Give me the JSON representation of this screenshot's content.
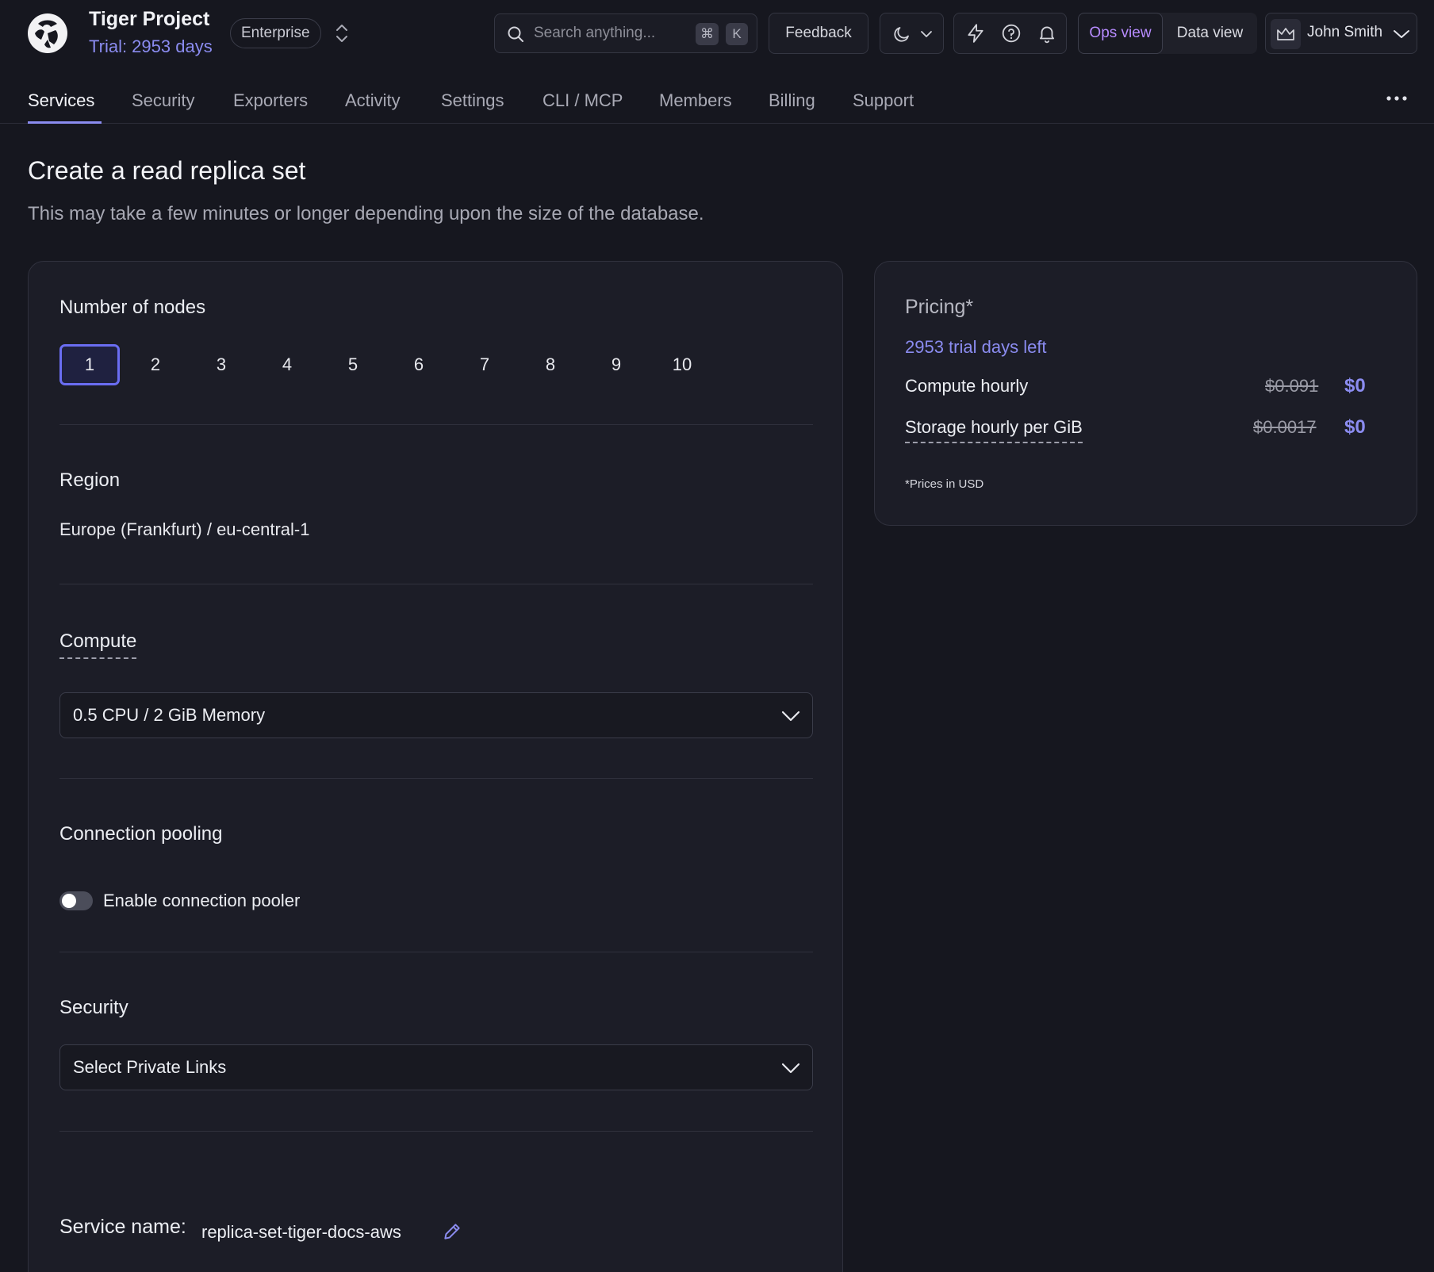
{
  "header": {
    "project_title": "Tiger Project",
    "trial": "Trial: 2953 days",
    "plan": "Enterprise",
    "search_placeholder": "Search anything...",
    "shortcut_cmd": "⌘",
    "shortcut_key": "K",
    "feedback": "Feedback",
    "view_ops": "Ops view",
    "view_data": "Data view",
    "user_name": "John Smith"
  },
  "tabs": [
    "Services",
    "Security",
    "Exporters",
    "Activity",
    "Settings",
    "CLI / MCP",
    "Members",
    "Billing",
    "Support"
  ],
  "page": {
    "title": "Create a read replica set",
    "subtitle": "This may take a few minutes or longer depending upon the size of the database."
  },
  "form": {
    "nodes_label": "Number of nodes",
    "nodes": [
      "1",
      "2",
      "3",
      "4",
      "5",
      "6",
      "7",
      "8",
      "9",
      "10"
    ],
    "selected_node": "1",
    "region_label": "Region",
    "region_value": "Europe (Frankfurt) / eu-central-1",
    "compute_label": "Compute",
    "compute_value": "0.5 CPU / 2 GiB Memory",
    "pooling_label": "Connection pooling",
    "pooler_toggle_label": "Enable connection pooler",
    "pooler_enabled": false,
    "security_label": "Security",
    "security_value": "Select Private Links",
    "service_name_label": "Service name:",
    "service_name_value": "replica-set-tiger-docs-aws"
  },
  "pricing": {
    "title": "Pricing*",
    "trial_days": "2953 trial days left",
    "compute_label": "Compute hourly",
    "compute_old": "$0.091",
    "compute_new": "$0",
    "storage_label": "Storage hourly per GiB",
    "storage_old": "$0.0017",
    "storage_new": "$0",
    "note": "*Prices in USD"
  },
  "colors": {
    "background": "#16171f",
    "card": "#1c1d27",
    "accent": "#8b8cf0",
    "ops_view": "#b78bff"
  }
}
